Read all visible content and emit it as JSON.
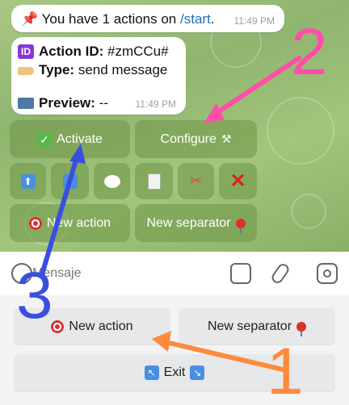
{
  "chat": {
    "message1": {
      "pin_emoji": "pushpin-icon",
      "text_before": "You have 1 actions on ",
      "link": "/start",
      "text_after": ".",
      "time": "11:49 PM"
    },
    "message2": {
      "id_label": "Action ID:",
      "id_value": "#zmCCu#",
      "type_label": "Type:",
      "type_value": "send message",
      "preview_label": "Preview:",
      "preview_value": "--",
      "time": "11:49 PM"
    },
    "inline_keyboard": {
      "activate": "Activate",
      "configure": "Configure",
      "new_action": "New action",
      "new_separator": "New separator"
    }
  },
  "compose": {
    "placeholder": "Mensaje"
  },
  "reply_keyboard": {
    "new_action": "New action",
    "new_separator": "New separator",
    "exit": "Exit"
  },
  "annotations": [
    {
      "number": "1",
      "color": "#ff8a3d"
    },
    {
      "number": "2",
      "color": "#ff4fa8"
    },
    {
      "number": "3",
      "color": "#3a4fe0"
    }
  ]
}
